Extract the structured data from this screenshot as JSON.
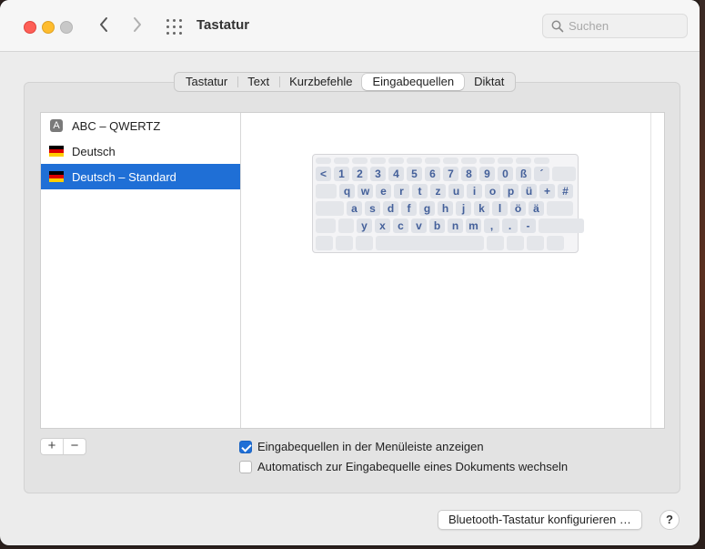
{
  "window": {
    "title": "Tastatur"
  },
  "search": {
    "placeholder": "Suchen"
  },
  "tabs": [
    {
      "label": "Tastatur"
    },
    {
      "label": "Text"
    },
    {
      "label": "Kurzbefehle"
    },
    {
      "label": "Eingabequellen",
      "active": true
    },
    {
      "label": "Diktat"
    }
  ],
  "sources": [
    {
      "label": "ABC – QWERTZ",
      "icon": "letter-a-icon",
      "icon_text": "A"
    },
    {
      "label": "Deutsch",
      "icon": "german-flag-icon"
    },
    {
      "label": "Deutsch – Standard",
      "icon": "german-flag-icon",
      "selected": true
    }
  ],
  "keyboard": {
    "row1": [
      "<",
      "1",
      "2",
      "3",
      "4",
      "5",
      "6",
      "7",
      "8",
      "9",
      "0",
      "ß",
      "´"
    ],
    "row2": [
      "q",
      "w",
      "e",
      "r",
      "t",
      "z",
      "u",
      "i",
      "o",
      "p",
      "ü",
      "+",
      "#"
    ],
    "row3": [
      "a",
      "s",
      "d",
      "f",
      "g",
      "h",
      "j",
      "k",
      "l",
      "ö",
      "ä"
    ],
    "row4": [
      "y",
      "x",
      "c",
      "v",
      "b",
      "n",
      "m",
      ",",
      ".",
      "-"
    ]
  },
  "list_controls": {
    "add": "+",
    "remove": "−"
  },
  "options": {
    "show_in_menubar": {
      "label": "Eingabequellen in der Menüleiste anzeigen",
      "checked": true
    },
    "auto_switch": {
      "label": "Automatisch zur Eingabequelle eines Dokuments wechseln",
      "checked": false
    }
  },
  "footer": {
    "bluetooth_button": "Bluetooth-Tastatur konfigurieren …",
    "help": "?"
  },
  "colors": {
    "accent": "#1f6fd6",
    "key_text": "#44609a"
  }
}
